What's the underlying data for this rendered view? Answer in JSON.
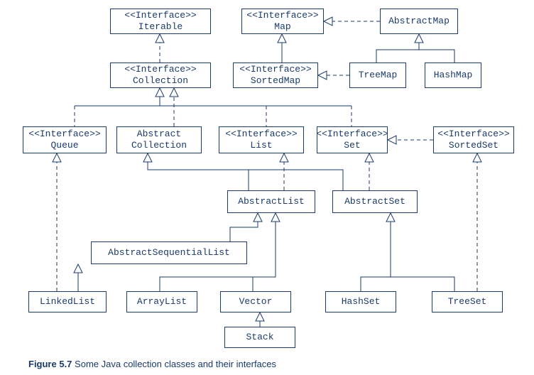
{
  "stereotype": "<<Interface>>",
  "nodes": {
    "iterable": "Iterable",
    "collection": "Collection",
    "map": "Map",
    "abstractMap": "AbstractMap",
    "sortedMap": "SortedMap",
    "treeMap": "TreeMap",
    "hashMap": "HashMap",
    "queue": "Queue",
    "abstractCollection_l1": "Abstract",
    "abstractCollection_l2": "Collection",
    "list": "List",
    "set": "Set",
    "sortedSet": "SortedSet",
    "abstractList": "AbstractList",
    "abstractSet": "AbstractSet",
    "abstractSequentialList": "AbstractSequentialList",
    "linkedList": "LinkedList",
    "arrayList": "ArrayList",
    "vector": "Vector",
    "hashSet": "HashSet",
    "treeSet": "TreeSet",
    "stack": "Stack"
  },
  "caption": {
    "label": "Figure 5.7",
    "text": "Some Java collection classes and their interfaces"
  }
}
